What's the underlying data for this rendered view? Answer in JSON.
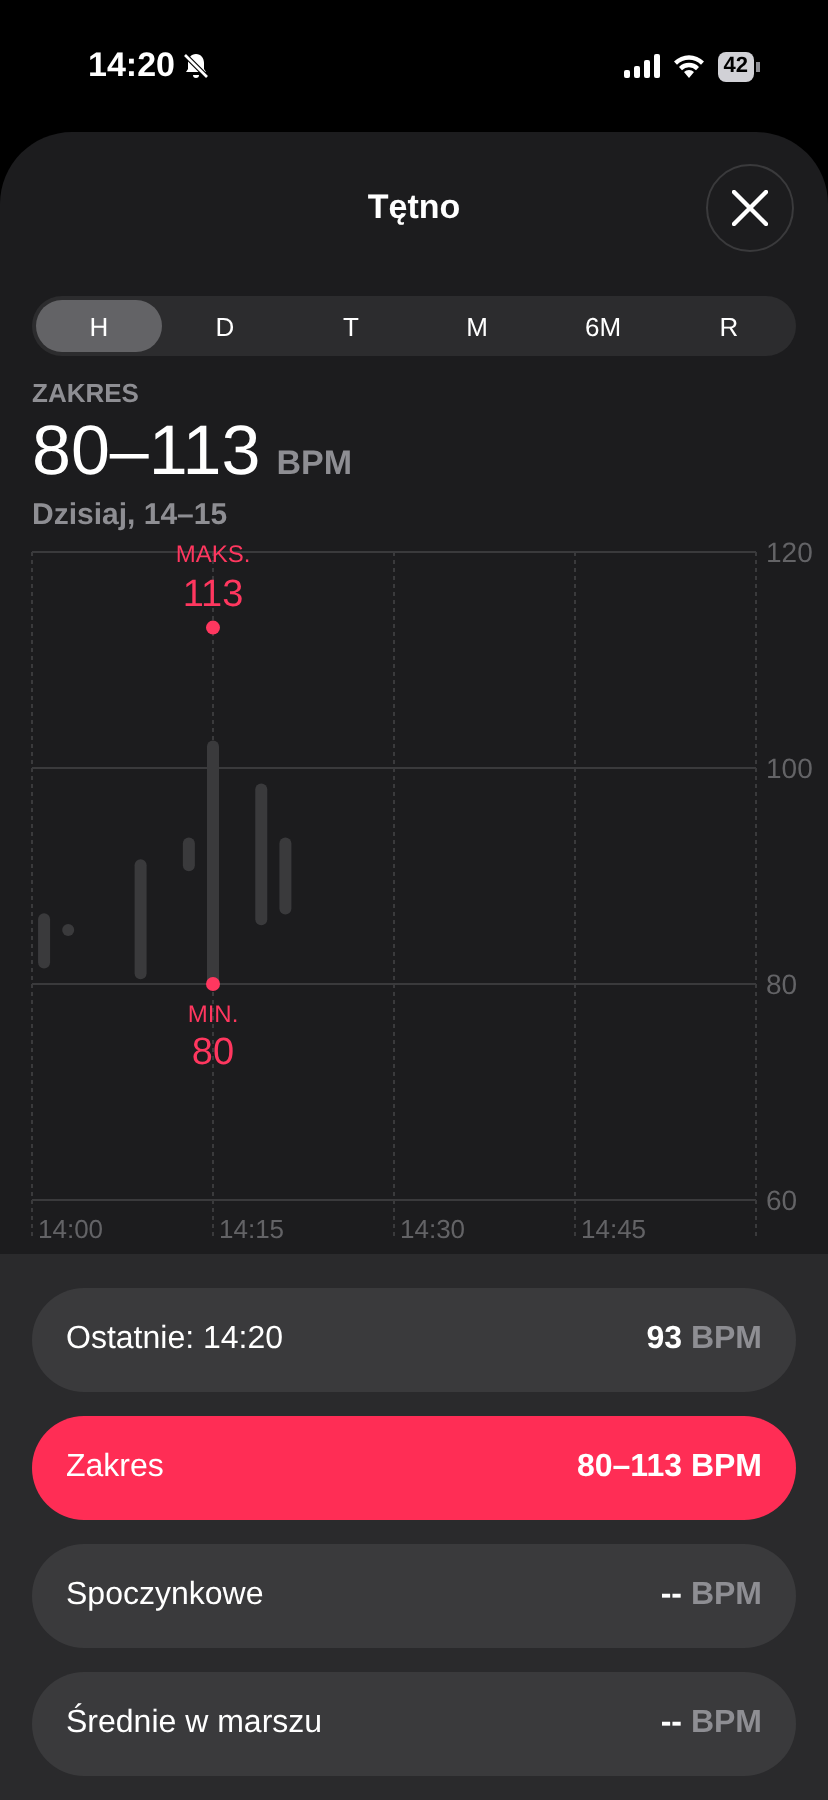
{
  "status_bar": {
    "time": "14:20",
    "battery": "42"
  },
  "header": {
    "title": "Tętno"
  },
  "periods": [
    {
      "label": "H",
      "selected": true
    },
    {
      "label": "D",
      "selected": false
    },
    {
      "label": "T",
      "selected": false
    },
    {
      "label": "M",
      "selected": false
    },
    {
      "label": "6M",
      "selected": false
    },
    {
      "label": "R",
      "selected": false
    }
  ],
  "summary": {
    "caption": "ZAKRES",
    "value": "80–113",
    "unit": "BPM",
    "date": "Dzisiaj, 14–15"
  },
  "chart": {
    "y_labels": [
      "120",
      "100",
      "80",
      "60"
    ],
    "x_labels": [
      "14:00",
      "14:15",
      "14:30",
      "14:45"
    ],
    "markers": [
      {
        "kind": "max",
        "label": "MAKS.",
        "value": "113"
      },
      {
        "kind": "min",
        "label": "MIN.",
        "value": "80"
      }
    ]
  },
  "stats": [
    {
      "label": "Ostatnie: 14:20",
      "value": "93",
      "unit": "BPM",
      "selected": false
    },
    {
      "label": "Zakres",
      "value": "80–113",
      "unit": "BPM",
      "selected": true
    },
    {
      "label": "Spoczynkowe",
      "value": "--",
      "unit": "BPM",
      "selected": false
    },
    {
      "label": "Średnie w marszu",
      "value": "--",
      "unit": "BPM",
      "selected": false
    }
  ]
}
